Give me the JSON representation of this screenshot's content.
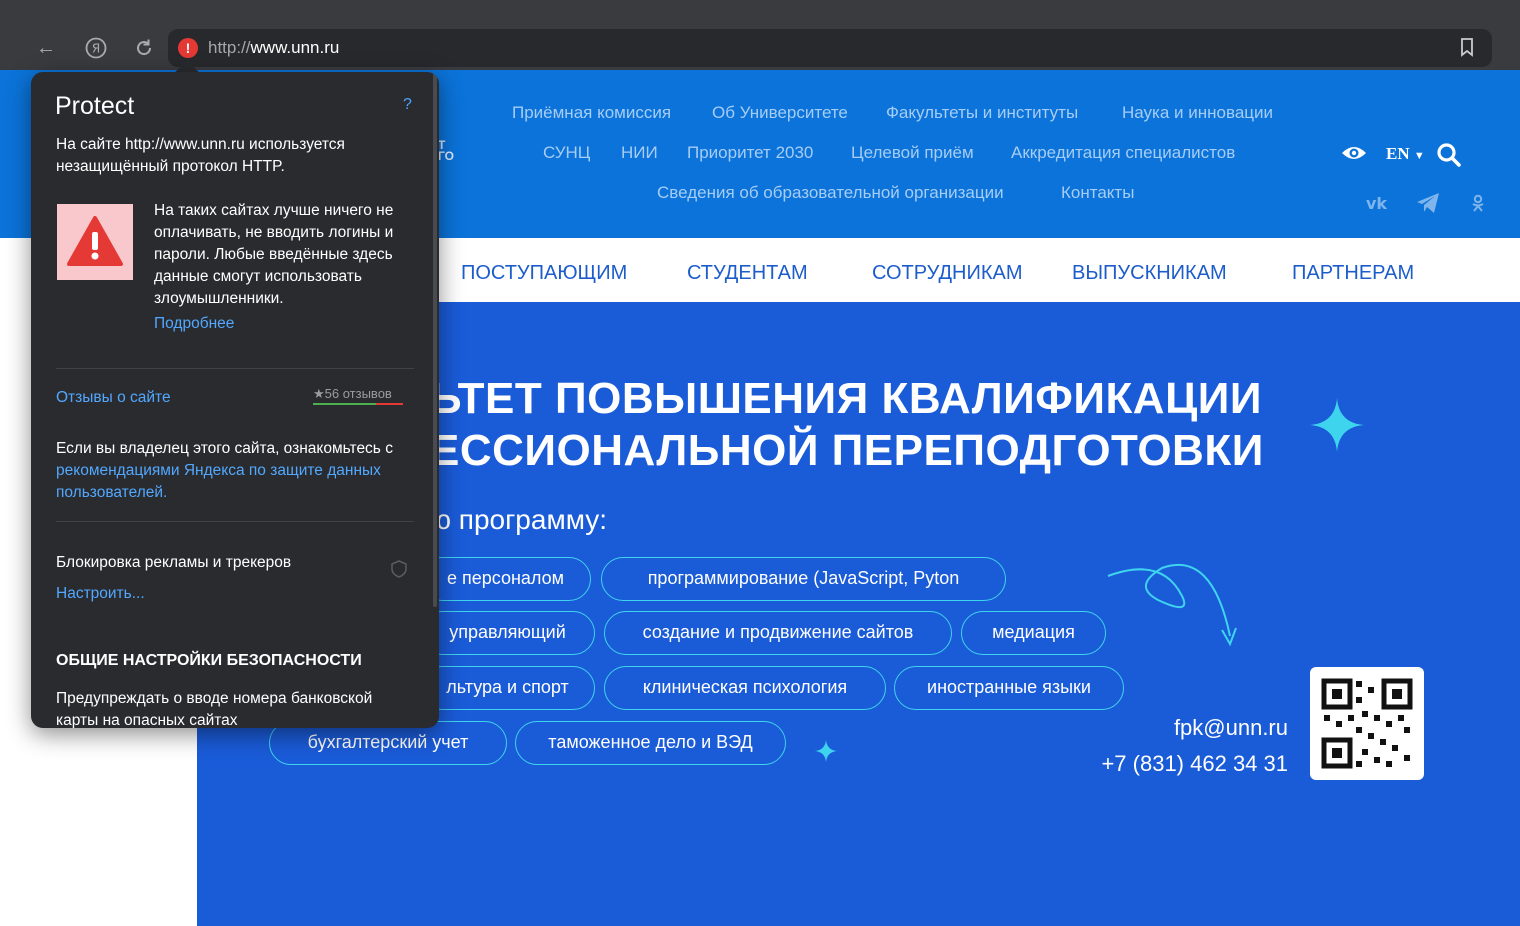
{
  "browser": {
    "url_scheme": "http://",
    "url_host": "www.unn.ru"
  },
  "header": {
    "links_row1": [
      "Приёмная комиссия",
      "Об Университете",
      "Факультеты и институты",
      "Наука и инновации"
    ],
    "links_row2": [
      "СУНЦ",
      "НИИ",
      "Приоритет 2030",
      "Целевой приём",
      "Аккредитация специалистов"
    ],
    "links_row3": [
      "Сведения об образовательной организации",
      "Контакты"
    ],
    "language": "EN",
    "logo_fragment_1": "Т",
    "logo_fragment_2": "ГО"
  },
  "nav": {
    "items": [
      "ПОСТУПАЮЩИМ",
      "СТУДЕНТАМ",
      "СОТРУДНИКАМ",
      "ВЫПУСКНИКАМ",
      "ПАРТНЕРАМ"
    ]
  },
  "hero": {
    "title_line1": "ЬТЕТ ПОВЫШЕНИЯ КВАЛИФИКАЦИИ",
    "title_line2": "ЕССИОНАЛЬНОЙ ПЕРЕПОДГОТОВКИ",
    "subtitle": "ю программу:",
    "pills": [
      "е персоналом",
      "программирование (JavaScript, Pyton",
      "управляющий",
      "создание и продвижение сайтов",
      "медиация",
      "льтура и спорт",
      "клиническая психология",
      "иностранные языки",
      "бухгалтерский учет",
      "таможенное дело и ВЭД"
    ],
    "email": "fpk@unn.ru",
    "phone": "+7 (831) 462 34 31"
  },
  "protect": {
    "title": "Protect",
    "help": "?",
    "intro": "На сайте http://www.unn.ru используется незащищённый протокол HTTP.",
    "warning": "На таких сайтах лучше ничего не оплачивать, не вводить логины и пароли. Любые введённые здесь данные смогут использовать злоумышленники.",
    "more_link": "Подробнее",
    "reviews_link": "Отзывы о сайте",
    "reviews_count": "56 отзывов",
    "owner_text": "Если вы владелец этого сайта, ознакомьтесь с",
    "owner_link": "рекомендациями Яндекса по защите данных пользователей.",
    "block_label": "Блокировка рекламы и трекеров",
    "configure_link": "Настроить...",
    "section_heading": "ОБЩИЕ НАСТРОЙКИ БЕЗОПАСНОСТИ",
    "bank_warning": "Предупреждать о вводе номера банковской карты на опасных сайтах"
  },
  "colors": {
    "header_blue": "#0b73d9",
    "hero_blue": "#1a5bd8",
    "accent_cyan": "#3fd4ee",
    "warning_red": "#e53935",
    "link_blue": "#52a8ff"
  }
}
